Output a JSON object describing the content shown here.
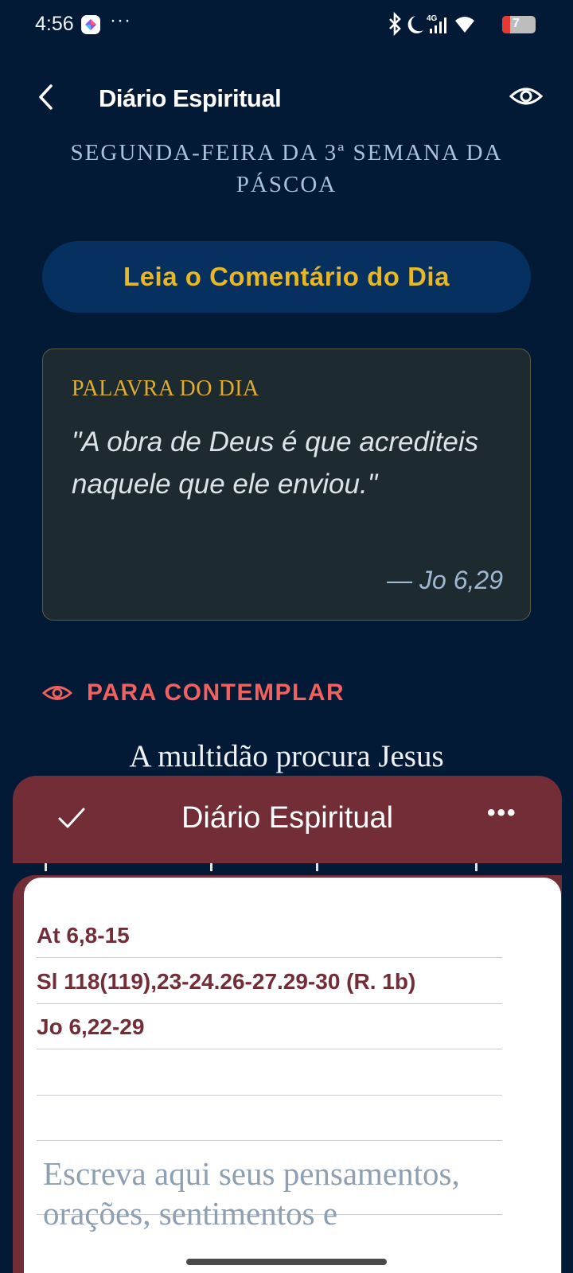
{
  "status_bar": {
    "time": "4:56",
    "more": "···",
    "battery": "7"
  },
  "header": {
    "title": "Diário Espiritual"
  },
  "liturgy_day": "SEGUNDA-FEIRA DA 3ª SEMANA DA PÁSCOA",
  "comment_button": "Leia o Comentário do Dia",
  "word_of_day": {
    "label": "PALAVRA DO DIA",
    "quote": "\"A obra de Deus é que acrediteis naquele que ele enviou.\"",
    "reference": "— Jo 6,29"
  },
  "contemplate": {
    "label": "PARA CONTEMPLAR",
    "title": "A multidão procura Jesus"
  },
  "sheet": {
    "title": "Diário Espiritual",
    "more": "•••",
    "readings": [
      "At 6,8-15",
      "Sl 118(119),23-24.26-27.29-30 (R. 1b)",
      "Jo 6,22-29"
    ],
    "placeholder": "Escreva aqui seus pensamentos, orações, sentimentos e"
  },
  "colors": {
    "background": "#031a36",
    "accent_gold": "#e8b726",
    "accent_red": "#f0615f",
    "sheet_wine": "#732d36"
  }
}
